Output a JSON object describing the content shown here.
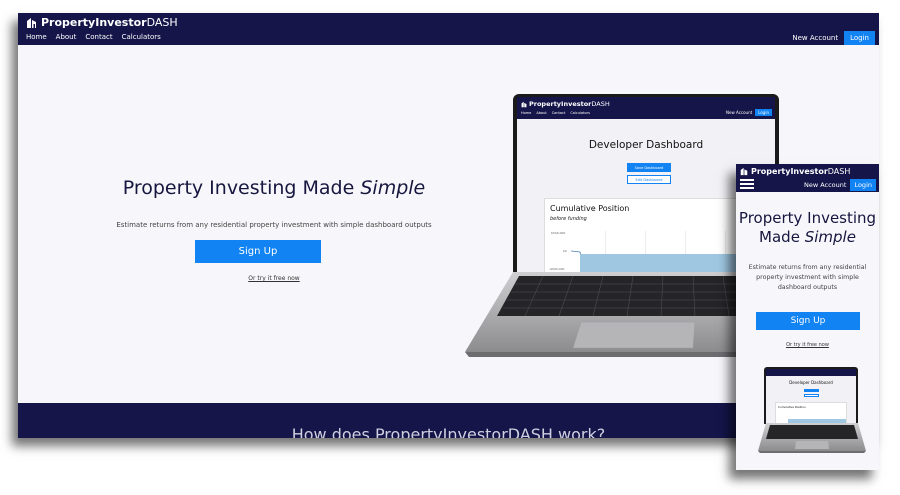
{
  "brand": {
    "bold": "PropertyInvestor",
    "light": "DASH"
  },
  "nav": {
    "links": [
      "Home",
      "About",
      "Contact",
      "Calculators"
    ],
    "new_account": "New Account",
    "login": "Login"
  },
  "hero": {
    "title_prefix": "Property Investing Made",
    "title_emph": "Simple",
    "subtitle": "Estimate returns from any residential property investment with simple dashboard outputs",
    "signup": "Sign Up",
    "try_link": "Or try it free now"
  },
  "footer": {
    "heading": "How does PropertyInvestorDASH work?"
  },
  "laptop": {
    "dashboard_title": "Developer Dashboard",
    "save_button": "Save Dashboard",
    "edit_button": "Edit Dashboard",
    "card_title": "Cumulative Position",
    "card_subtitle": "before funding",
    "ticks": [
      "$500,000",
      "$0",
      "-$500,000"
    ]
  },
  "colors": {
    "navy": "#15154a",
    "accent": "#1283f3",
    "page_bg": "#f7f7fb",
    "chart_fill": "#9fc7e2"
  }
}
